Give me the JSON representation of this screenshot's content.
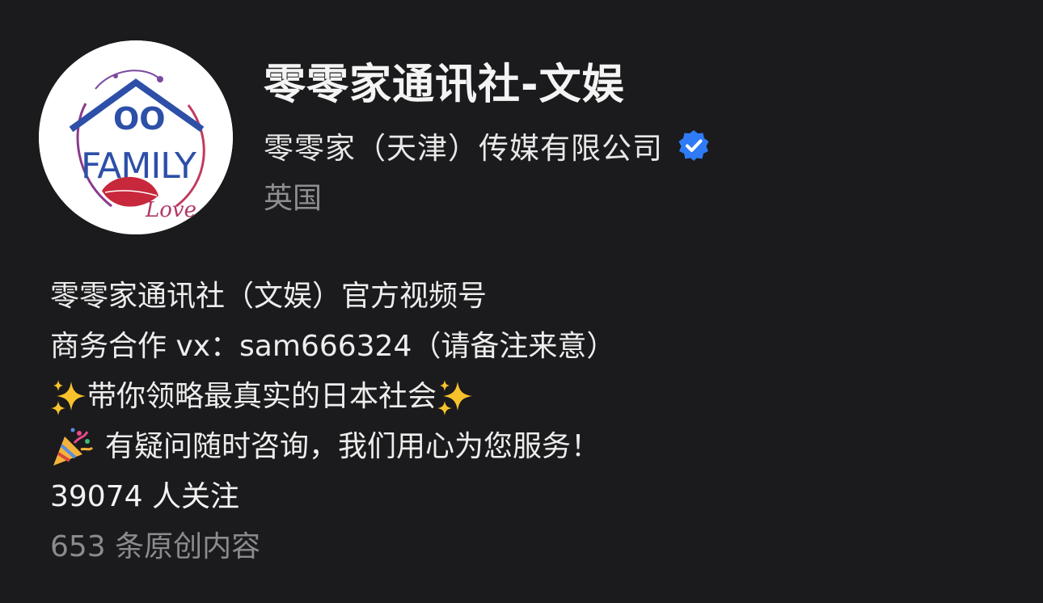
{
  "profile": {
    "name": "零零家通讯社-文娱",
    "organization": "零零家（天津）传媒有限公司",
    "location": "英国",
    "verified_icon": "verified-badge-icon",
    "avatar": {
      "logo_text_top": "OO",
      "logo_text_main": "FAMILY",
      "logo_text_script": "Love"
    }
  },
  "bio": {
    "line1": "零零家通讯社（文娱）官方视频号",
    "line2": "商务合作 vx：sam666324（请备注来意）",
    "line3": "带你领略最真实的日本社会",
    "line4": "有疑问随时咨询，我们用心为您服务！"
  },
  "stats": {
    "followers": "39074 人关注",
    "original_content": "653 条原创内容"
  },
  "colors": {
    "background": "#1b1a1c",
    "verified_blue": "#2f7bf5",
    "secondary_text": "#8e8e91"
  }
}
